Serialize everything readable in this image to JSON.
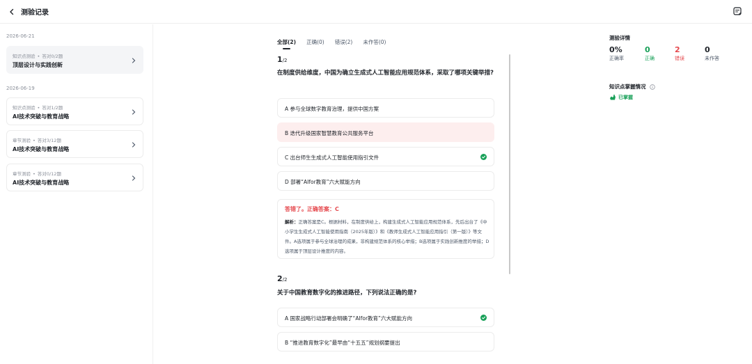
{
  "header": {
    "title": "测验记录"
  },
  "sidebar": {
    "groups": [
      {
        "date": "2026-06-21",
        "records": [
          {
            "type": "知识点测验",
            "progress": "答对0/2题",
            "name": "顶层设计与实践创新"
          }
        ]
      },
      {
        "date": "2026-06-19",
        "records": [
          {
            "type": "知识点测验",
            "progress": "答对1/2题",
            "name": "AI技术突破与教育战略"
          },
          {
            "type": "章节测验",
            "progress": "答对3/12题",
            "name": "AI技术突破与教育战略"
          },
          {
            "type": "章节测验",
            "progress": "答对0/12题",
            "name": "AI技术突破与教育战略"
          }
        ]
      }
    ],
    "separator": "•"
  },
  "tabs": [
    {
      "label": "全部(2)"
    },
    {
      "label": "正确(0)"
    },
    {
      "label": "错误(2)"
    },
    {
      "label": "未作答(0)"
    }
  ],
  "questions": [
    {
      "num": "1",
      "total": "/2",
      "text": "在制度供给维度，中国为确立生成式人工智能应用规范体系，采取了哪项关键举措?",
      "options": [
        "A  参与全球数字教育治理，提供中国方案",
        "B  迭代升级国家智慧教育公共服务平台",
        "C  出台师生生成式人工智能使用指引文件",
        "D  部署“AIfor教育”六大赋能方向"
      ],
      "result": "答错了。正确答案：C",
      "explain_label": "解析：",
      "explain_text": "正确答案是C。根据材料，在制度供给上，构建生成式人工智能应用规范体系，先后出台了《中小学生生成式人工智能使用指南（2025年版）》和《教师生成式人工智能应用指引（第一版）》等文件。A选项属于参与全球治理的成果，非构建规范体系的核心举措；B选项属于实践创新推度的举措；D选项属于顶层设计推度的内容。"
    },
    {
      "num": "2",
      "total": "/2",
      "text": "关于中国教育数字化的推进路径，下列说法正确的是?",
      "options": [
        "A  国家战略行动部署会明确了“AIfor教育”六大赋能方向",
        "B  “推进教育数字化”最早由“十五五”规划纲要提出"
      ]
    }
  ],
  "stats": {
    "title": "测验详情",
    "items": [
      {
        "value": "0%",
        "label": "正确率",
        "color": "#1f2329"
      },
      {
        "value": "0",
        "label": "正确",
        "color": "#18a058"
      },
      {
        "value": "2",
        "label": "错误",
        "color": "#e5484d"
      },
      {
        "value": "0",
        "label": "未作答",
        "color": "#1f2329"
      }
    ]
  },
  "knowledge": {
    "title": "知识点掌握情况",
    "status": "已掌握"
  },
  "colors": {
    "correct": "#18a058",
    "wrong": "#e5484d",
    "wrong_bg": "#fdeeee"
  },
  "icons": [
    "back-arrow-icon",
    "note-icon",
    "chevron-right-icon",
    "check-circle-icon",
    "info-icon",
    "mastered-icon"
  ]
}
